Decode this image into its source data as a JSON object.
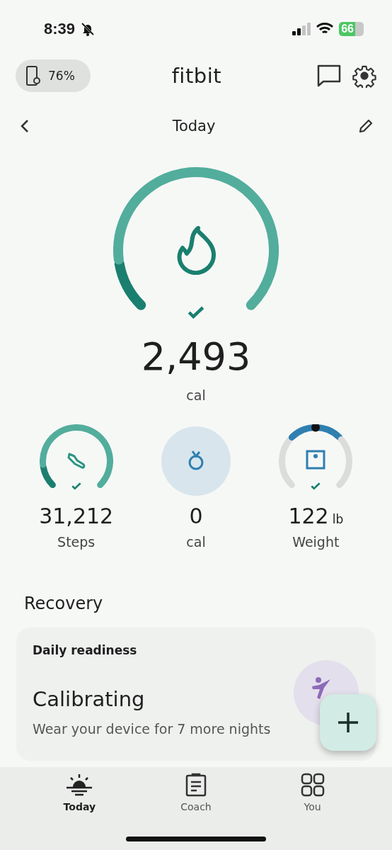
{
  "status_bar": {
    "time": "8:39",
    "battery": "66"
  },
  "header": {
    "device_battery": "76%",
    "logo": "fitbit"
  },
  "date_nav": {
    "title": "Today"
  },
  "main_stat": {
    "value": "2,493",
    "unit": "cal",
    "goal_met": true
  },
  "stats": [
    {
      "kind": "steps",
      "value": "31,212",
      "label": "Steps",
      "goal_met": true
    },
    {
      "kind": "food",
      "value": "0",
      "label": "cal"
    },
    {
      "kind": "weight",
      "value": "122",
      "unit": "lb",
      "label": "Weight",
      "goal_met": true
    }
  ],
  "section_title": "Recovery",
  "readiness_card": {
    "title": "Daily readiness",
    "status": "Calibrating",
    "message": "Wear your device for 7 more nights"
  },
  "tab_bar": [
    {
      "kind": "today",
      "label": "Today",
      "selected": true
    },
    {
      "kind": "coach",
      "label": "Coach",
      "selected": false
    },
    {
      "kind": "you",
      "label": "You",
      "selected": false
    }
  ]
}
